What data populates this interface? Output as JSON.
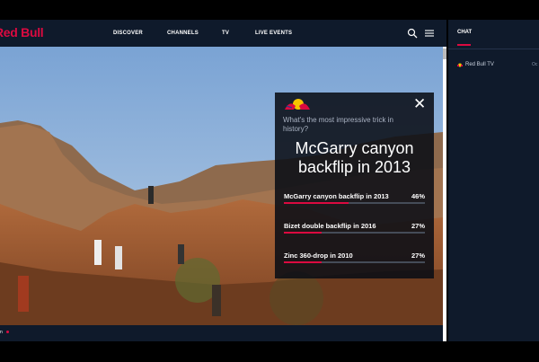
{
  "header": {
    "logo_text": "Red Bull",
    "nav": [
      "DISCOVER",
      "CHANNELS",
      "TV",
      "LIVE EVENTS"
    ]
  },
  "icons": {
    "search": "search-icon",
    "menu": "hamburger-menu-icon",
    "close": "close-icon"
  },
  "chat": {
    "tab_label": "CHAT",
    "channel_name": "Red Bull TV",
    "channel_extra": "Oc"
  },
  "poll": {
    "question": "What's the most impressive trick in history?",
    "answer": "McGarry canyon backflip in 2013",
    "options": [
      {
        "label": "McGarry canyon backflip in 2013",
        "percent_text": "46%",
        "percent": 46
      },
      {
        "label": "Bizet double backflip in 2016",
        "percent_text": "27%",
        "percent": 27
      },
      {
        "label": "Zinc 360-drop in 2010",
        "percent_text": "27%",
        "percent": 27
      }
    ]
  },
  "bottom": {
    "label": "n"
  },
  "colors": {
    "brand_red": "#db0a40",
    "nav_bg": "#0f1a2b",
    "poll_bg": "#0a0e16",
    "poll_track": "#454c58"
  }
}
